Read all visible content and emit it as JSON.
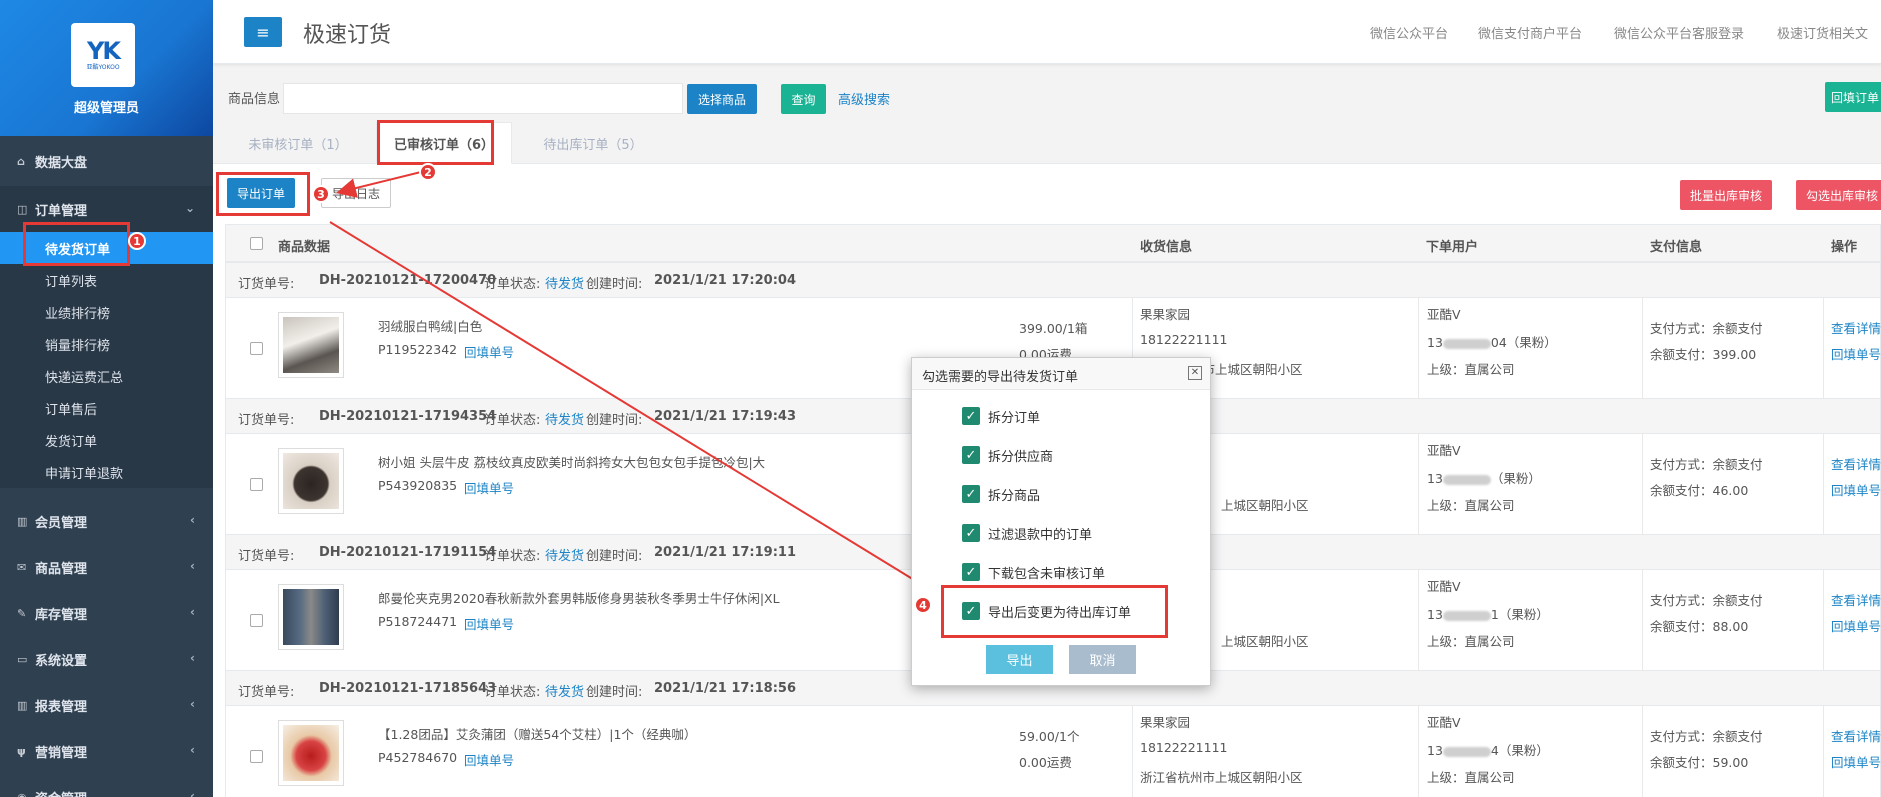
{
  "sidebar": {
    "logo_mark": "YK",
    "logo_word": "亚酷YOKOO",
    "role": "超级管理员",
    "dashboard": "数据大盘",
    "order_mgmt": "订单管理",
    "sub_items": [
      "待发货订单",
      "订单列表",
      "业绩排行榜",
      "销量排行榜",
      "快递运费汇总",
      "订单售后",
      "发货订单",
      "申请订单退款"
    ],
    "groups": [
      "会员管理",
      "商品管理",
      "库存管理",
      "系统设置",
      "报表管理",
      "营销管理",
      "资金管理"
    ]
  },
  "topbar": {
    "title": "极速订货",
    "links": [
      "微信公众平台",
      "微信支付商户平台",
      "微信公众平台客服登录",
      "极速订货相关文"
    ]
  },
  "filter": {
    "label": "商品信息",
    "input_value": "",
    "select_goods": "选择商品",
    "query": "查询",
    "advanced": "高级搜索",
    "fill_order": "回填订单"
  },
  "tabs": [
    "未审核订单（1）",
    "已审核订单（6）",
    "待出库订单（5）"
  ],
  "toolbar": {
    "export": "导出订单",
    "export_log": "导出日志",
    "batch_audit": "批量出库审核",
    "selected_audit": "勾选出库审核"
  },
  "table": {
    "headers": [
      "商品数据",
      "收货信息",
      "下单用户",
      "支付信息",
      "操作"
    ]
  },
  "orders": [
    {
      "no_label": "订货单号:",
      "no": "DH-20210121-17200470",
      "status_label": "订单状态:",
      "status": "待发货",
      "time_label": "创建时间:",
      "time": "2021/1/21 17:20:04",
      "product": "羽绒服白鸭绒|白色",
      "sku": "P119522342",
      "fill": "回填单号",
      "price": "399.00/1箱",
      "freight": "0.00运费",
      "receiver": "果果家园",
      "phone": "18122221111",
      "address": "浙江省杭州市上城区朝阳小区",
      "user": "亚酷V",
      "user_phone": "13",
      "user_phone_tail": "04（果粉）",
      "superior": "上级：直属公司",
      "pay_method": "支付方式：余额支付",
      "pay_amount": "余额支付：399.00",
      "view": "查看详情",
      "fill_no": "回填单号"
    },
    {
      "no_label": "订货单号:",
      "no": "DH-20210121-17194354",
      "status_label": "订单状态:",
      "status": "待发货",
      "time_label": "创建时间:",
      "time": "2021/1/21 17:19:43",
      "product": "树小姐 头层牛皮 荔枝纹真皮欧美时尚斜挎女大包包女包手提包冷包|大",
      "sku": "P543920835",
      "fill": "回填单号",
      "price": "",
      "freight": "",
      "receiver": "",
      "phone": "",
      "address": "上城区朝阳小区",
      "user": "亚酷V",
      "user_phone": "13",
      "user_phone_tail": "（果粉）",
      "superior": "上级：直属公司",
      "pay_method": "支付方式：余额支付",
      "pay_amount": "余额支付：46.00",
      "view": "查看详情",
      "fill_no": "回填单号"
    },
    {
      "no_label": "订货单号:",
      "no": "DH-20210121-17191154",
      "status_label": "订单状态:",
      "status": "待发货",
      "time_label": "创建时间:",
      "time": "2021/1/21 17:19:11",
      "product": "郎曼伦夹克男2020春秋新款外套男韩版修身男装秋冬季男士牛仔休闲|XL",
      "sku": "P518724471",
      "fill": "回填单号",
      "price": "",
      "freight": "",
      "receiver": "",
      "phone": "",
      "address": "上城区朝阳小区",
      "user": "亚酷V",
      "user_phone": "13",
      "user_phone_tail": "1（果粉）",
      "superior": "上级：直属公司",
      "pay_method": "支付方式：余额支付",
      "pay_amount": "余额支付：88.00",
      "view": "查看详情",
      "fill_no": "回填单号"
    },
    {
      "no_label": "订货单号:",
      "no": "DH-20210121-17185643",
      "status_label": "订单状态:",
      "status": "待发货",
      "time_label": "创建时间:",
      "time": "2021/1/21 17:18:56",
      "product": "【1.28团品】艾灸蒲团（赠送54个艾柱）|1个（经典咖）",
      "sku": "P452784670",
      "fill": "回填单号",
      "price": "59.00/1个",
      "freight": "0.00运费",
      "receiver": "果果家园",
      "phone": "18122221111",
      "address": "浙江省杭州市上城区朝阳小区",
      "user": "亚酷V",
      "user_phone": "13",
      "user_phone_tail": "4（果粉）",
      "superior": "上级：直属公司",
      "pay_method": "支付方式：余额支付",
      "pay_amount": "余额支付：59.00",
      "view": "查看详情",
      "fill_no": "回填单号"
    }
  ],
  "modal": {
    "title": "勾选需要的导出待发货订单",
    "close": "✕",
    "options": [
      "拆分订单",
      "拆分供应商",
      "拆分商品",
      "过滤退款中的订单",
      "下载包含未审核订单",
      "导出后变更为待出库订单"
    ],
    "export": "导出",
    "cancel": "取消"
  },
  "badges": [
    "1",
    "2",
    "3",
    "4"
  ],
  "colors": {
    "sidebar": "#2f4050",
    "accent": "#2196f3",
    "highlight": "#e53935"
  }
}
